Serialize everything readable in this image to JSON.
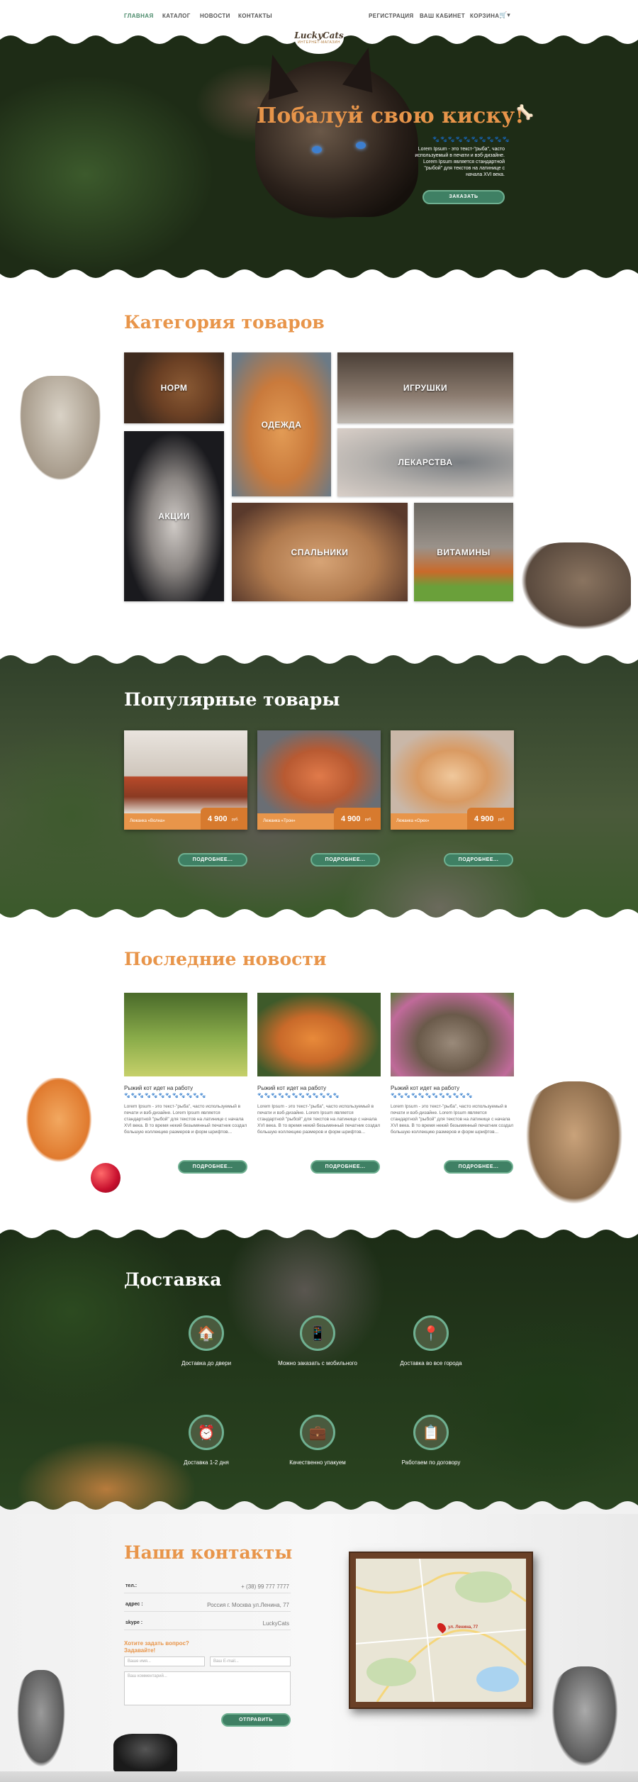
{
  "nav": {
    "items": [
      {
        "label": "ГЛАВНАЯ",
        "active": true
      },
      {
        "label": "КАТАЛОГ"
      },
      {
        "label": "НОВОСТИ"
      },
      {
        "label": "КОНТАКТЫ"
      }
    ],
    "right": [
      {
        "label": "РЕГИСТРАЦИЯ"
      },
      {
        "label": "ВАШ КАБИНЕТ"
      },
      {
        "label": "КОРЗИНА"
      }
    ],
    "cart_caret": "▾",
    "logo_top": "LuckyCats",
    "logo_bottom": "ИНТЕРНЕТ-МАГАЗИН"
  },
  "hero": {
    "title": "Побалуй свою киску!",
    "text": "Lorem Ipsum - это текст-\"рыба\", часто используемый в печати и вэб-дизайне. Lorem Ipsum является стандартной \"рыбой\" для текстов на латинице с начала XVI века.",
    "button": "ЗАКАЗАТЬ",
    "paws": "🐾🐾🐾🐾🐾🐾🐾🐾🐾🐾"
  },
  "categories": {
    "title": "Категория товаров",
    "items": [
      {
        "label": "НОРМ"
      },
      {
        "label": "ОДЕЖДА"
      },
      {
        "label": "ИГРУШКИ"
      },
      {
        "label": "ЛЕКАРСТВА"
      },
      {
        "label": "АКЦИИ"
      },
      {
        "label": "СПАЛЬНИКИ"
      },
      {
        "label": "ВИТАМИНЫ"
      }
    ]
  },
  "popular": {
    "title": "Популярные товары",
    "items": [
      {
        "name": "Лежанка «Волна»",
        "price": "4 900",
        "unit": "руб.",
        "button": "ПОДРОБНЕЕ..."
      },
      {
        "name": "Лежанка «Трон»",
        "price": "4 900",
        "unit": "руб.",
        "button": "ПОДРОБНЕЕ..."
      },
      {
        "name": "Лежанка «Орех»",
        "price": "4 900",
        "unit": "руб.",
        "button": "ПОДРОБНЕЕ..."
      }
    ]
  },
  "news": {
    "title": "Последние новости",
    "items": [
      {
        "heading": "Рыжий кот идет на работу",
        "text": "Lorem Ipsum - это текст-\"рыба\", часто используемый в печати и вэб-дизайне. Lorem Ipsum является стандартной \"рыбой\" для текстов на латинице с начала XVI века. В то время некий безымянный печатник создал большую коллекцию размеров и форм шрифтов...",
        "button": "ПОДРОБНЕЕ..."
      },
      {
        "heading": "Рыжий кот идет на работу",
        "text": "Lorem Ipsum - это текст-\"рыба\", часто используемый в печати и вэб-дизайне. Lorem Ipsum является стандартной \"рыбой\" для текстов на латинице с начала XVI века. В то время некий безымянный печатник создал большую коллекцию размеров и форм шрифтов...",
        "button": "ПОДРОБНЕЕ..."
      },
      {
        "heading": "Рыжий кот идет на работу",
        "text": "Lorem Ipsum - это текст-\"рыба\", часто используемый в печати и вэб-дизайне. Lorem Ipsum является стандартной \"рыбой\" для текстов на латинице с начала XVI века. В то время некий безымянный печатник создал большую коллекцию размеров и форм шрифтов...",
        "button": "ПОДРОБНЕЕ..."
      }
    ],
    "paws": "🐾🐾🐾🐾🐾🐾🐾🐾🐾🐾🐾🐾"
  },
  "delivery": {
    "title": "Доставка",
    "items": [
      {
        "label": "Доставка до двери",
        "icon": "house-icon",
        "glyph": "🏠"
      },
      {
        "label": "Можно заказать с мобильного",
        "icon": "phone-icon",
        "glyph": "📱"
      },
      {
        "label": "Доставка во все города",
        "icon": "location-pin-icon",
        "glyph": "📍"
      },
      {
        "label": "Доставка 1-2 дня",
        "icon": "clock-icon",
        "glyph": "⏰"
      },
      {
        "label": "Качественно упакуем",
        "icon": "suitcase-icon",
        "glyph": "💼"
      },
      {
        "label": "Работаем по договору",
        "icon": "clipboard-icon",
        "glyph": "📋"
      }
    ]
  },
  "contacts": {
    "title": "Наши контакты",
    "rows": [
      {
        "key": "тел.:",
        "value": "+ (38) 99 777 7777"
      },
      {
        "key": "адрес :",
        "value": "Россия г. Москва ул.Ленина, 77"
      },
      {
        "key": "skype :",
        "value": "LuckyCats"
      }
    ],
    "question": "Хотите задать вопрос?",
    "question2": "Задавайте!",
    "name_placeholder": "Ваше имя...",
    "email_placeholder": "Ваш E-mail...",
    "comment_placeholder": "Ваш комментарий...",
    "submit": "ОТПРАВИТЬ",
    "map_label": "ул. Ленина, 77"
  },
  "colors": {
    "accent": "#e8954a",
    "green": "#3f8064"
  }
}
